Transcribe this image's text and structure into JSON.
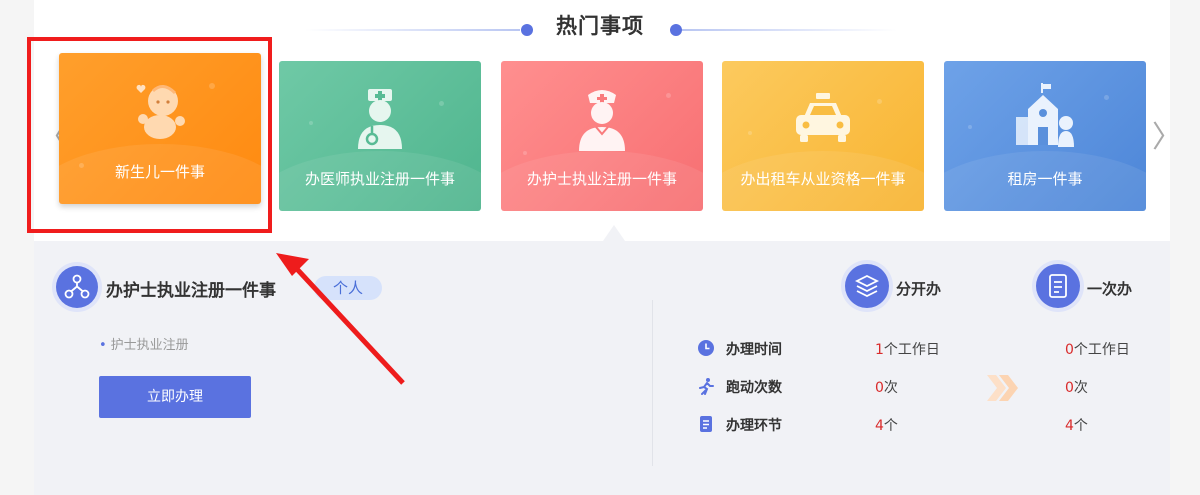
{
  "section": {
    "title": "热门事项"
  },
  "nav": {
    "prev_glyph": "〈",
    "next_glyph": "〉"
  },
  "cards": [
    {
      "label": "新生儿一件事",
      "icon": "baby-icon",
      "color": "#ff8f1a"
    },
    {
      "label": "办医师执业注册一件事",
      "icon": "doctor-icon",
      "color": "#58bb95"
    },
    {
      "label": "办护士执业注册一件事",
      "icon": "nurse-icon",
      "color": "#f97a7c"
    },
    {
      "label": "办出租车从业资格一件事",
      "icon": "taxi-icon",
      "color": "#f9bd42"
    },
    {
      "label": "租房一件事",
      "icon": "house-icon",
      "color": "#5a90dc"
    }
  ],
  "detail": {
    "title": "办护士执业注册一件事",
    "tag": "个人",
    "items": [
      "护士执业注册"
    ],
    "button": "立即办理",
    "modes": [
      "分开办",
      "一次办"
    ],
    "rows": [
      {
        "label": "办理时间",
        "icon": "clock-icon",
        "separate_num": "1",
        "separate_unit": "个工作日",
        "once_num": "0",
        "once_unit": "个工作日"
      },
      {
        "label": "跑动次数",
        "icon": "runner-icon",
        "separate_num": "0",
        "separate_unit": "次",
        "once_num": "0",
        "once_unit": "次"
      },
      {
        "label": "办理环节",
        "icon": "document-icon",
        "separate_num": "4",
        "separate_unit": "个",
        "once_num": "4",
        "once_unit": "个"
      }
    ]
  },
  "colors": {
    "accent": "#5a72e0",
    "highlight": "#f01d1d",
    "number": "#d92b2b"
  }
}
